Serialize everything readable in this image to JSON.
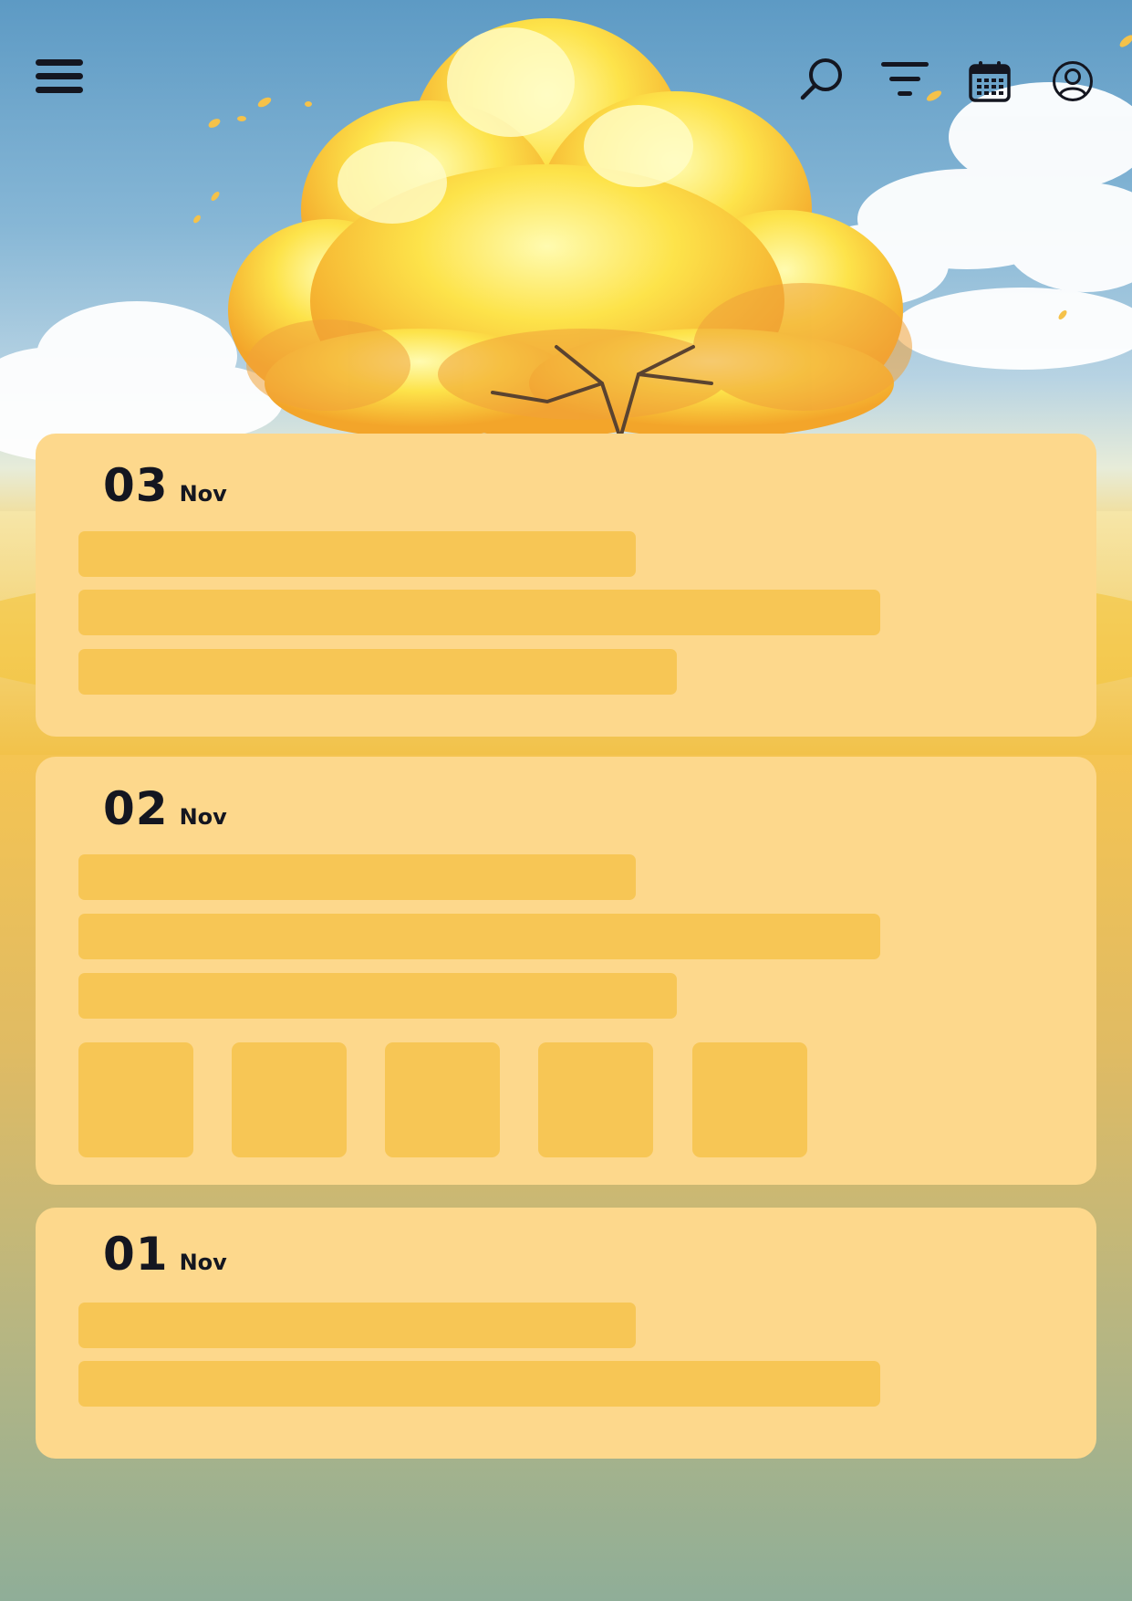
{
  "topbar": {
    "icons": [
      "menu-icon",
      "search-icon",
      "filter-icon",
      "calendar-icon",
      "user-icon"
    ]
  },
  "entries": [
    {
      "day": "03",
      "month": "Nov",
      "line_count": 3,
      "thumbnail_count": 0
    },
    {
      "day": "02",
      "month": "Nov",
      "line_count": 3,
      "thumbnail_count": 5
    },
    {
      "day": "01",
      "month": "Nov",
      "line_count": 2,
      "thumbnail_count": 0
    }
  ],
  "colors": {
    "card": "#fdd88c",
    "skeleton": "#f7c655",
    "text": "#141620",
    "icon": "#141620"
  }
}
